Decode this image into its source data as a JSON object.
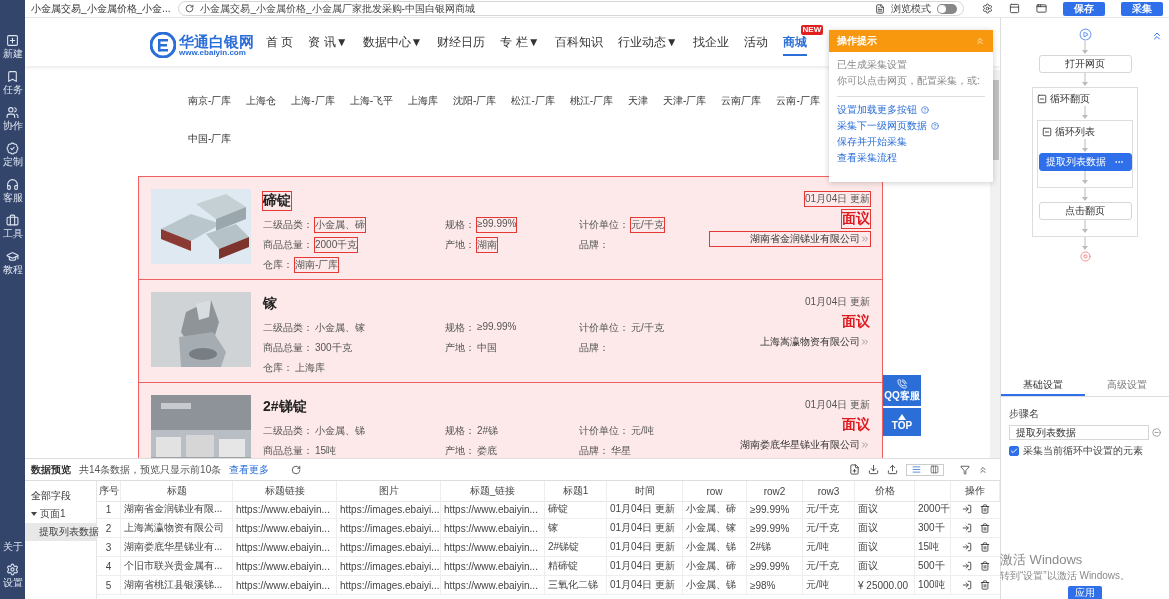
{
  "left_nav": {
    "top_items": [
      {
        "label": "新建"
      },
      {
        "label": "任务"
      },
      {
        "label": "协作"
      },
      {
        "label": "定制"
      },
      {
        "label": "客服"
      },
      {
        "label": "工具"
      },
      {
        "label": "教程"
      }
    ],
    "bottom_items": [
      {
        "label": "关于"
      },
      {
        "label": "设置"
      }
    ]
  },
  "top_bar": {
    "tab_title": "小金属交易_小金属价格_小金...",
    "address": "小金属交易_小金属价格_小金属厂家批发采购-中国白银网商城",
    "browse_mode": {
      "label": "浏览模式",
      "on": false
    },
    "buttons": [
      "保存",
      "采集"
    ]
  },
  "site": {
    "logo": {
      "name": "华通白银网",
      "url": "www.ebaiyin.com"
    },
    "nav": [
      {
        "label": "首 页",
        "selected": false
      },
      {
        "label": "资 讯▼",
        "selected": false
      },
      {
        "label": "数据中心▼",
        "selected": false
      },
      {
        "label": "财经日历",
        "selected": false
      },
      {
        "label": "专 栏▼",
        "selected": false
      },
      {
        "label": "百科知识",
        "selected": false
      },
      {
        "label": "行业动态▼",
        "selected": false
      },
      {
        "label": "找企业",
        "selected": false
      },
      {
        "label": "活动",
        "selected": false
      },
      {
        "label": "商城",
        "selected": true,
        "badge": "NEW"
      }
    ],
    "warehouse_rows": [
      [
        "南京-厂库",
        "上海仓",
        "上海-厂库",
        "上海-飞平",
        "上海库",
        "沈阳-厂库",
        "松江-厂库",
        "桃江-厂库",
        "天津",
        "天津-厂库",
        "云南厂库",
        "云南-厂库"
      ],
      [
        "中国-厂库"
      ]
    ],
    "products": [
      {
        "title": "碲锭",
        "selected": true,
        "date": "01月04日 更新",
        "price": "面议",
        "company": "湖南省金润锑业有限公司",
        "fields": [
          {
            "label": "二级品类：",
            "value": "小金属、碲"
          },
          {
            "label": "规格：",
            "value": "≥99.99%"
          },
          {
            "label": "计价单位：",
            "value": "元/千克"
          },
          {
            "label": "商品总量：",
            "value": "2000千克"
          },
          {
            "label": "产地：",
            "value": "湖南"
          },
          {
            "label": "品牌："
          },
          {
            "label": "仓库：",
            "value": "湖南-厂库"
          }
        ]
      },
      {
        "title": "镓",
        "selected": false,
        "date": "01月04日 更新",
        "price": "面议",
        "company": "上海嵩瀛物资有限公司",
        "fields": [
          {
            "label": "二级品类：",
            "value": "小金属、镓"
          },
          {
            "label": "规格：",
            "value": "≥99.99%"
          },
          {
            "label": "计价单位：",
            "value": "元/千克"
          },
          {
            "label": "商品总量：",
            "value": "300千克"
          },
          {
            "label": "产地：",
            "value": "中国"
          },
          {
            "label": "品牌："
          },
          {
            "label": "仓库：",
            "value": "上海库"
          }
        ]
      },
      {
        "title": "2#锑锭",
        "selected": false,
        "date": "01月04日 更新",
        "price": "面议",
        "company": "湖南娄底华星锑业有限公司",
        "fields": [
          {
            "label": "二级品类：",
            "value": "小金属、锑"
          },
          {
            "label": "规格：",
            "value": "2#锑"
          },
          {
            "label": "计价单位：",
            "value": "元/吨"
          },
          {
            "label": "商品总量：",
            "value": "15吨"
          },
          {
            "label": "产地：",
            "value": "娄底"
          },
          {
            "label": "品牌：",
            "value": "华星"
          }
        ]
      }
    ],
    "float_buttons": [
      "QQ客服",
      "TOP"
    ]
  },
  "popup": {
    "title": "操作提示",
    "lines": [
      "已生成采集设置",
      "你可以点击网页，配置采集，或:"
    ],
    "links": [
      {
        "label": "设置加载更多按钮",
        "help": true
      },
      {
        "label": "采集下一级网页数据",
        "help": true
      },
      {
        "label": "保存并开始采集",
        "help": false
      },
      {
        "label": "查看采集流程",
        "help": false
      }
    ]
  },
  "flow": {
    "open_step": "打开网页",
    "page_loop": {
      "label": "循环翻页",
      "expanded": true,
      "list_loop": {
        "label": "循环列表",
        "expanded": true,
        "step": {
          "label": "提取列表数据",
          "selected": true
        }
      },
      "after_step": {
        "label": "点击翻页",
        "selected": false
      }
    }
  },
  "settings": {
    "tabs": [
      {
        "label": "基础设置",
        "selected": true
      },
      {
        "label": "高级设置",
        "selected": false
      }
    ],
    "step_name": {
      "label": "步骤名",
      "value": "提取列表数据"
    },
    "option": {
      "label": "采集当前循环中设置的元素",
      "checked": true
    },
    "apply": "应用"
  },
  "preview": {
    "title": "数据预览",
    "summary": "共14条数据，预览只显示前10条",
    "more": "查看更多",
    "view_modes": [
      {
        "selected": true
      },
      {
        "selected": false
      }
    ],
    "field_tree": {
      "title": "全部字段",
      "pages": [
        {
          "label": "页面1",
          "expanded": true,
          "children": [
            {
              "label": "提取列表数据",
              "selected": true
            }
          ]
        }
      ]
    },
    "table": {
      "columns": [
        "序号",
        "标题",
        "标题链接",
        "图片",
        "标题_链接",
        "标题1",
        "时间",
        "row",
        "row2",
        "row3",
        "价格"
      ],
      "action_header": "操作",
      "rows": [
        {
          "cells": [
            "1",
            "湖南省金润锑业有限...",
            "https://www.ebaiyin...",
            "https://images.ebaiyi...",
            "https://www.ebaiyin...",
            "碲锭",
            "01月04日 更新",
            "小金属、碲",
            "≥99.99%",
            "元/千克",
            "面议",
            "2000千"
          ]
        },
        {
          "cells": [
            "2",
            "上海嵩瀛物资有限公司",
            "https://www.ebaiyin...",
            "https://images.ebaiyi...",
            "https://www.ebaiyin...",
            "镓",
            "01月04日 更新",
            "小金属、镓",
            "≥99.99%",
            "元/千克",
            "面议",
            "300千"
          ]
        },
        {
          "cells": [
            "3",
            "湖南娄底华星锑业有...",
            "https://www.ebaiyin...",
            "https://images.ebaiyi...",
            "https://www.ebaiyin...",
            "2#锑锭",
            "01月04日 更新",
            "小金属、锑",
            "2#锑",
            "元/吨",
            "面议",
            "15吨"
          ]
        },
        {
          "cells": [
            "4",
            "个旧市联兴贵金属有...",
            "https://www.ebaiyin...",
            "https://images.ebaiyi...",
            "https://www.ebaiyin...",
            "精碲锭",
            "01月04日 更新",
            "小金属、碲",
            "≥99.99%",
            "元/千克",
            "面议",
            "500千"
          ]
        },
        {
          "cells": [
            "5",
            "湖南省桃江县银溪锑...",
            "https://www.ebaiyin...",
            "https://images.ebaiyi...",
            "https://www.ebaiyin...",
            "三氧化二锑",
            "01月04日 更新",
            "小金属、锑",
            "≥98%",
            "元/吨",
            "¥ 25000.00",
            "100吨"
          ]
        }
      ]
    }
  },
  "os_notice": {
    "title": "激活 Windows",
    "text": "转到“设置”以激活 Windows。"
  }
}
